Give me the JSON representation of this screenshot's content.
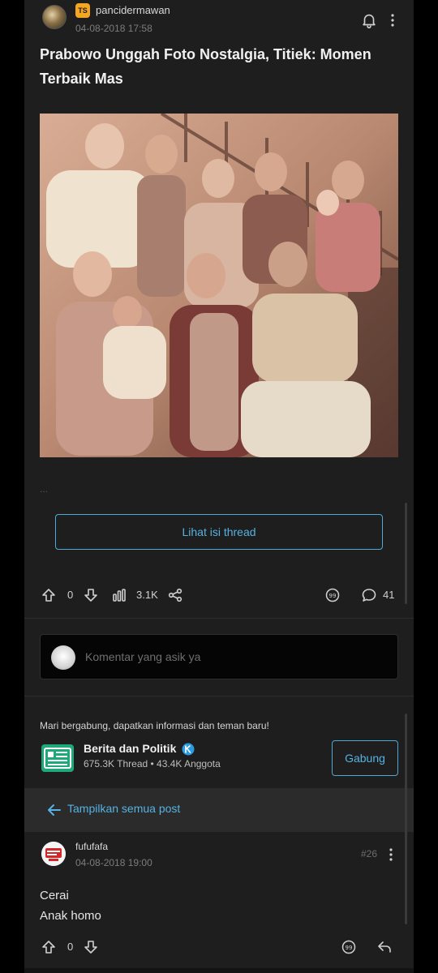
{
  "post": {
    "username": "pancidermawan",
    "ts_badge": "TS",
    "date": "04-08-2018 17:58",
    "title": "Prabowo Unggah Foto Nostalgia, Titiek: Momen Terbaik Mas",
    "ellipsis": "...",
    "view_thread_label": "Lihat isi thread",
    "upvotes": "0",
    "views": "3.1K",
    "comments": "41"
  },
  "comment_input": {
    "placeholder": "Komentar yang asik ya"
  },
  "community": {
    "invite_text": "Mari bergabung, dapatkan informasi dan teman baru!",
    "name": "Berita dan Politik",
    "stats": "675.3K Thread • 43.4K Anggota",
    "join_label": "Gabung"
  },
  "show_all": {
    "label": "Tampilkan semua post"
  },
  "reply": {
    "username": "fufufafa",
    "date": "04-08-2018 19:00",
    "number": "#26",
    "body_line1": "Cerai",
    "body_line2": "Anak homo",
    "upvotes": "0"
  },
  "colors": {
    "background": "#1e1e1e",
    "accent": "#56b2e2",
    "ts_badge": "#f5a623",
    "community_icon": "#1fa97b"
  }
}
